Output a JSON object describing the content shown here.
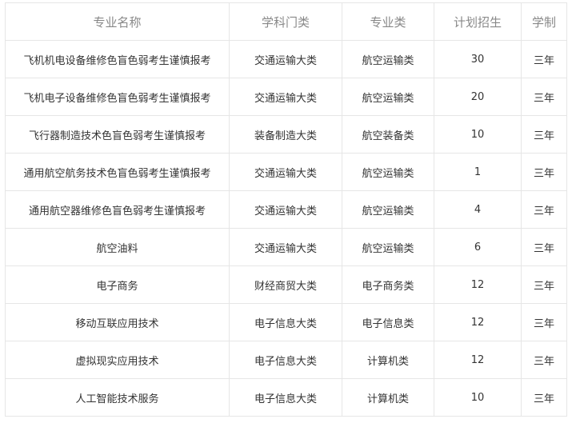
{
  "table": {
    "headers": [
      "专业名称",
      "学科门类",
      "专业类",
      "计划招生",
      "学制"
    ],
    "rows": [
      [
        "飞机机电设备维修色盲色弱考生谨慎报考",
        "交通运输大类",
        "航空运输类",
        "30",
        "三年"
      ],
      [
        "飞机电子设备维修色盲色弱考生谨慎报考",
        "交通运输大类",
        "航空运输类",
        "20",
        "三年"
      ],
      [
        "飞行器制造技术色盲色弱考生谨慎报考",
        "装备制造大类",
        "航空装备类",
        "10",
        "三年"
      ],
      [
        "通用航空航务技术色盲色弱考生谨慎报考",
        "交通运输大类",
        "航空运输类",
        "1",
        "三年"
      ],
      [
        "通用航空器维修色盲色弱考生谨慎报考",
        "交通运输大类",
        "航空运输类",
        "4",
        "三年"
      ],
      [
        "航空油料",
        "交通运输大类",
        "航空运输类",
        "6",
        "三年"
      ],
      [
        "电子商务",
        "财经商贸大类",
        "电子商务类",
        "12",
        "三年"
      ],
      [
        "移动互联应用技术",
        "电子信息大类",
        "电子信息类",
        "12",
        "三年"
      ],
      [
        "虚拟现实应用技术",
        "电子信息大类",
        "计算机类",
        "12",
        "三年"
      ],
      [
        "人工智能技术服务",
        "电子信息大类",
        "计算机类",
        "10",
        "三年"
      ]
    ]
  },
  "colors": {
    "border": "#e6e6e6",
    "header_text": "#888888",
    "body_text": "#333333"
  }
}
